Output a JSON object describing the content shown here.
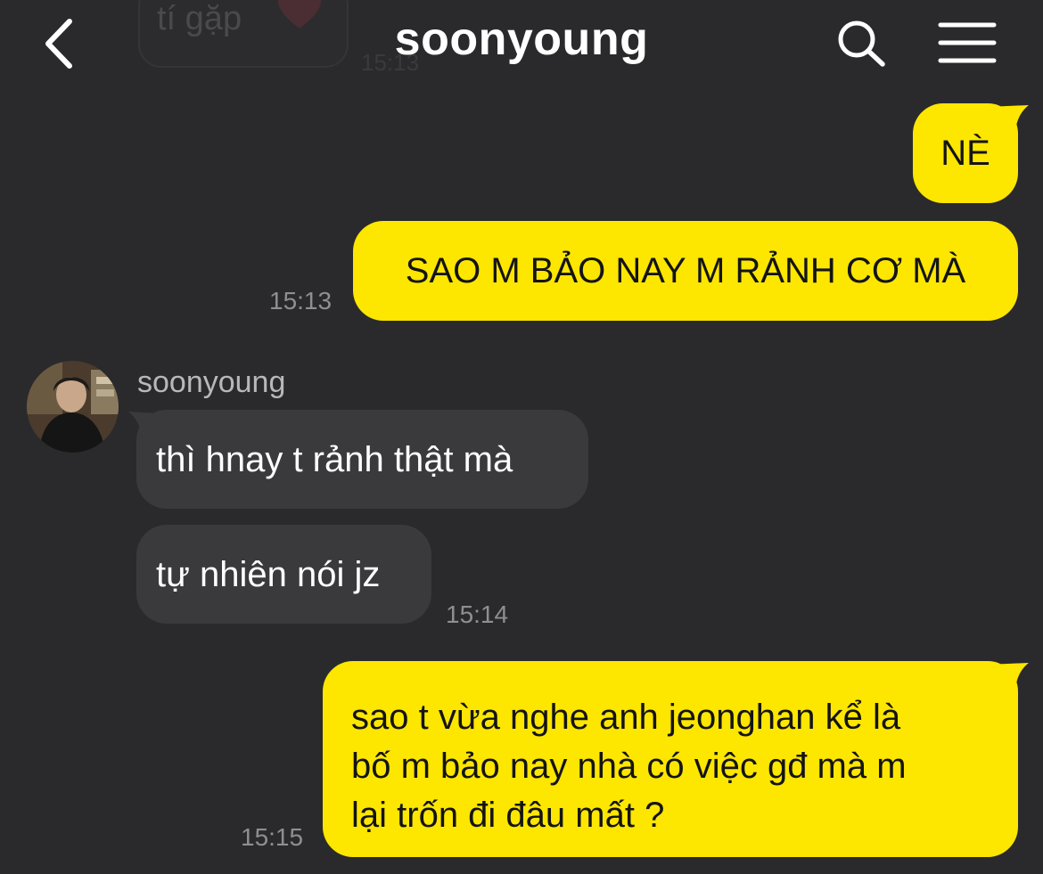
{
  "background_message": {
    "text": "tí gặp",
    "time": "15:13"
  },
  "header": {
    "title": "soonyoung",
    "back_icon": "chevron-left-icon",
    "search_icon": "search-icon",
    "menu_icon": "hamburger-menu-icon"
  },
  "colors": {
    "background": "#2a2a2c",
    "my_bubble": "#fde600",
    "their_bubble": "#3a3a3c",
    "timestamp": "#8e8e93"
  },
  "messages": [
    {
      "sender": "me",
      "text": "NÈ"
    },
    {
      "sender": "me",
      "text": "SAO M BẢO NAY M RẢNH CƠ MÀ",
      "time": "15:13"
    },
    {
      "sender": "them",
      "sender_name": "soonyoung",
      "text": "thì hnay t rảnh thật mà"
    },
    {
      "sender": "them",
      "text": "tự nhiên nói jz",
      "time": "15:14"
    },
    {
      "sender": "me",
      "lines": [
        "sao t vừa nghe anh jeonghan kể là",
        "bố m bảo nay nhà có việc gđ mà m",
        "lại trốn đi đâu mất ?"
      ],
      "time": "15:15"
    }
  ]
}
